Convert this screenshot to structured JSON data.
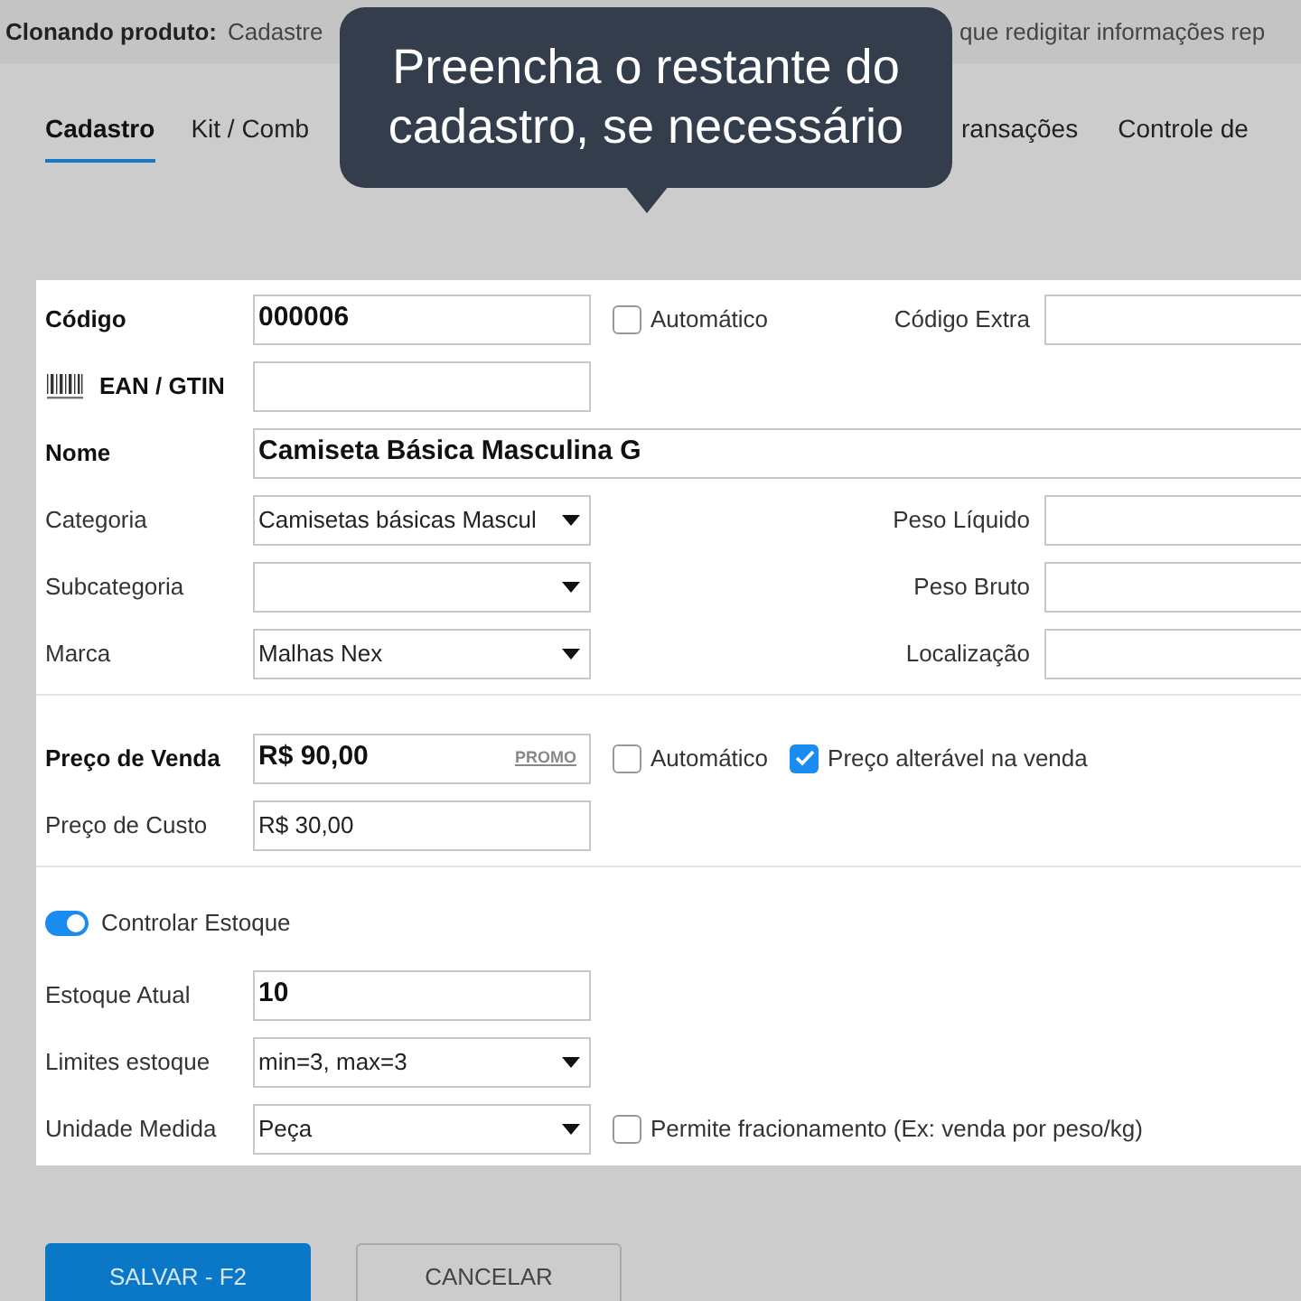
{
  "banner": {
    "label": "Clonando produto:",
    "fragments": [
      "Cadastre",
      "que redigitar informações rep"
    ]
  },
  "tabs": [
    {
      "label": "Cadastro",
      "selected": true
    },
    {
      "label": "Kit / Comb",
      "selected": false
    },
    {
      "label": "ransações",
      "selected": false
    },
    {
      "label": "Controle de",
      "selected": false
    }
  ],
  "tooltip": {
    "text": "Preencha o restante do cadastro, se necessário"
  },
  "sections": [
    {
      "rows": [
        {
          "kind": "field",
          "label": "Código",
          "bold": true,
          "field": {
            "kind": "text",
            "value": "000006",
            "strong": true
          },
          "after": [
            {
              "label": "Automático",
              "checked": false
            }
          ],
          "side": {
            "label": "Código Extra"
          }
        },
        {
          "kind": "field",
          "label": "EAN / GTIN",
          "bold": true,
          "barcode": true,
          "field": {
            "kind": "text"
          }
        },
        {
          "kind": "field",
          "label": "Nome",
          "bold": true,
          "field": {
            "kind": "text",
            "value": "Camiseta Básica Masculina G",
            "strong": true,
            "wide": true
          }
        },
        {
          "kind": "field",
          "label": "Categoria",
          "bold": false,
          "field": {
            "kind": "select",
            "value": "Camisetas básicas Mascul"
          },
          "side": {
            "label": "Peso Líquido"
          }
        },
        {
          "kind": "field",
          "label": "Subcategoria",
          "bold": false,
          "field": {
            "kind": "select"
          },
          "side": {
            "label": "Peso Bruto"
          }
        },
        {
          "kind": "field",
          "label": "Marca",
          "bold": false,
          "field": {
            "kind": "select",
            "value": "Malhas Nex"
          },
          "side": {
            "label": "Localização"
          }
        }
      ]
    },
    {
      "rows": [
        {
          "kind": "field",
          "label": "Preço de Venda",
          "bold": true,
          "field": {
            "kind": "text",
            "value": "R$ 90,00",
            "strong": true,
            "badge": "PROMO"
          },
          "after": [
            {
              "label": "Automático",
              "checked": false
            },
            {
              "label": "Preço alterável na venda",
              "checked": true
            }
          ]
        },
        {
          "kind": "field",
          "label": "Preço de Custo",
          "bold": false,
          "field": {
            "kind": "text",
            "value": "R$ 30,00"
          }
        }
      ]
    },
    {
      "rows": [
        {
          "kind": "toggle",
          "label": "Controlar Estoque",
          "on": true
        },
        {
          "kind": "field",
          "label": "Estoque Atual",
          "bold": false,
          "field": {
            "kind": "text",
            "value": "10",
            "strong": true
          }
        },
        {
          "kind": "field",
          "label": "Limites estoque",
          "bold": false,
          "field": {
            "kind": "select",
            "value": "min=3, max=3"
          }
        },
        {
          "kind": "field",
          "label": "Unidade Medida",
          "bold": false,
          "field": {
            "kind": "select",
            "value": "Peça"
          },
          "after": [
            {
              "label": "Permite fracionamento (Ex: venda por peso/kg)",
              "checked": false
            }
          ]
        }
      ]
    }
  ],
  "buttons": [
    {
      "kind": "primary",
      "label": "SALVAR - F2"
    },
    {
      "kind": "secondary",
      "label": "CANCELAR"
    }
  ]
}
